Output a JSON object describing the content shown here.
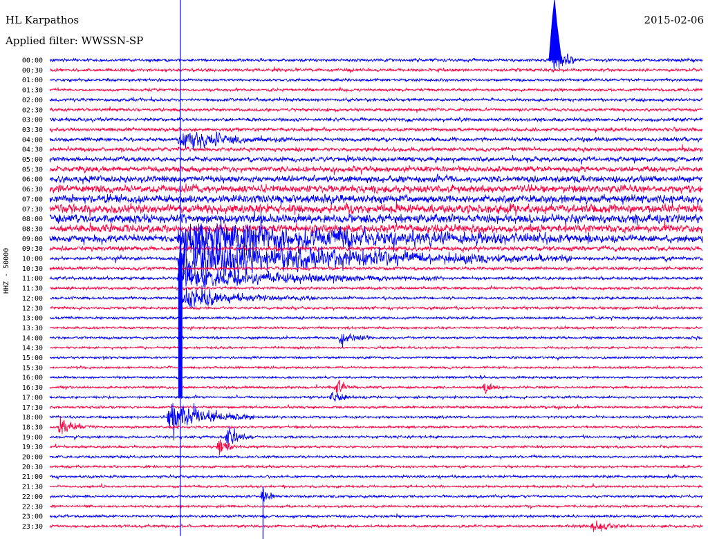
{
  "header": {
    "station": "HL Karpathos",
    "date": "2015-02-06",
    "filter": "Applied filter: WWSSN-SP"
  },
  "chart_data": {
    "type": "line",
    "title": "HL Karpathos",
    "subtitle": "Applied filter: WWSSN-SP",
    "ylabel": "HHZ - 50000",
    "xlabel": "",
    "date": "2015-02-06",
    "grid": false,
    "legend": "none",
    "row_labels": [
      "00:00",
      "00:30",
      "01:00",
      "01:30",
      "02:00",
      "02:30",
      "03:00",
      "03:30",
      "04:00",
      "04:30",
      "05:00",
      "05:30",
      "06:00",
      "06:30",
      "07:00",
      "07:30",
      "08:00",
      "08:30",
      "09:00",
      "09:30",
      "10:00",
      "10:30",
      "11:00",
      "11:30",
      "12:00",
      "12:30",
      "13:00",
      "13:30",
      "14:00",
      "14:30",
      "15:00",
      "15:30",
      "16:00",
      "16:30",
      "17:00",
      "17:30",
      "18:00",
      "18:30",
      "19:00",
      "19:30",
      "20:00",
      "20:30",
      "21:00",
      "21:30",
      "22:00",
      "22:30",
      "23:00",
      "23:30"
    ],
    "noise_amplitude": [
      1.0,
      1.0,
      0.9,
      0.9,
      1.0,
      1.0,
      1.1,
      1.2,
      1.3,
      1.4,
      1.6,
      1.9,
      2.2,
      2.5,
      2.8,
      3.0,
      3.0,
      2.8,
      2.5,
      1.6,
      1.2,
      1.1,
      1.0,
      0.95,
      0.9,
      0.9,
      0.85,
      0.8,
      0.8,
      0.75,
      0.75,
      0.75,
      0.75,
      0.8,
      0.8,
      0.8,
      0.8,
      0.8,
      0.8,
      0.8,
      0.8,
      0.8,
      0.8,
      0.8,
      0.8,
      0.8,
      0.85,
      0.85
    ],
    "colors": [
      "#0000ff",
      "#ff0040"
    ],
    "events": [
      {
        "row": 0,
        "minute": 23.2,
        "amp": 6,
        "dur": 1.2
      },
      {
        "row": 8,
        "minute": 6.0,
        "amp": 4,
        "dur": 5
      },
      {
        "row": 18,
        "minute": 6.0,
        "amp": 6,
        "dur": 20
      },
      {
        "row": 20,
        "minute": 6.0,
        "amp": 9,
        "dur": 18
      },
      {
        "row": 22,
        "minute": 6.0,
        "amp": 4,
        "dur": 12
      },
      {
        "row": 24,
        "minute": 6.2,
        "amp": 4,
        "dur": 6
      },
      {
        "row": 28,
        "minute": 13.4,
        "amp": 3,
        "dur": 1.5
      },
      {
        "row": 33,
        "minute": 13.2,
        "amp": 3,
        "dur": 1.0
      },
      {
        "row": 34,
        "minute": 13.0,
        "amp": 3,
        "dur": 1.0
      },
      {
        "row": 33,
        "minute": 20.0,
        "amp": 2.5,
        "dur": 1.0
      },
      {
        "row": 36,
        "minute": 5.5,
        "amp": 8,
        "dur": 4
      },
      {
        "row": 37,
        "minute": 0.5,
        "amp": 4,
        "dur": 1.5
      },
      {
        "row": 38,
        "minute": 8.2,
        "amp": 4,
        "dur": 1.2
      },
      {
        "row": 39,
        "minute": 7.8,
        "amp": 3,
        "dur": 1.0
      },
      {
        "row": 44,
        "minute": 9.8,
        "amp": 4,
        "dur": 0.6
      },
      {
        "row": 47,
        "minute": 25.0,
        "amp": 3,
        "dur": 1.5
      }
    ]
  }
}
